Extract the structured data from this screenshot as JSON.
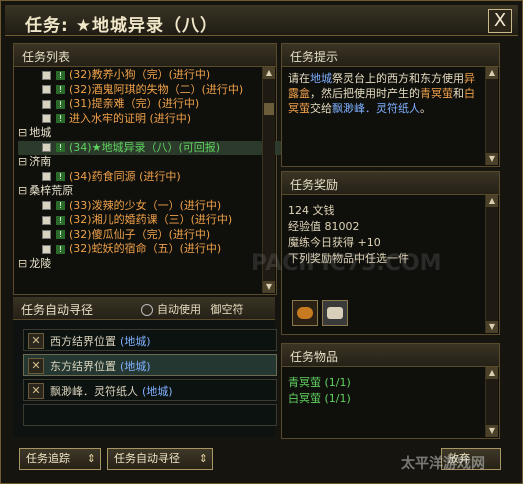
{
  "window": {
    "title": "任务: ★地城异录（八）",
    "close_label": "X"
  },
  "task_list": {
    "header": "任务列表",
    "items": [
      {
        "text": "(32)教养小狗（完）(进行中)",
        "type": "quest",
        "state": "orange"
      },
      {
        "text": "(32)酒鬼阿琪的失物（二）(进行中)",
        "type": "quest",
        "state": "orange"
      },
      {
        "text": "(31)提亲难（完）(进行中)",
        "type": "quest",
        "state": "orange"
      },
      {
        "text": "进入水牢的证明 (进行中)",
        "type": "quest",
        "state": "orange"
      },
      {
        "text": "地城",
        "type": "category"
      },
      {
        "text": "(34)★地城异录（八）(可回报)",
        "type": "quest",
        "state": "green"
      },
      {
        "text": "济南",
        "type": "category"
      },
      {
        "text": "(34)药食同源 (进行中)",
        "type": "quest",
        "state": "orange"
      },
      {
        "text": "桑梓荒原",
        "type": "category"
      },
      {
        "text": "(33)泼辣的少女（一）(进行中)",
        "type": "quest",
        "state": "orange"
      },
      {
        "text": "(32)湘儿的婚药课（三）(进行中)",
        "type": "quest",
        "state": "orange"
      },
      {
        "text": "(32)傻瓜仙子（完）(进行中)",
        "type": "quest",
        "state": "orange"
      },
      {
        "text": "(32)蛇妖的宿命（五）(进行中)",
        "type": "quest",
        "state": "orange"
      },
      {
        "text": "龙陵",
        "type": "category"
      }
    ]
  },
  "auto_route": {
    "header": "任务自动寻径",
    "auto_use_label": "自动使用",
    "item_name": "御空符",
    "rows": [
      {
        "text": "西方结界位置",
        "map": "(地城)"
      },
      {
        "text": "东方结界位置",
        "map": "(地城)"
      },
      {
        "text": "飘渺峰．灵符纸人",
        "map": "(地城)"
      }
    ]
  },
  "buttons": {
    "track": "任务追踪",
    "auto_route": "任务自动寻径",
    "abandon": "放弃"
  },
  "hint": {
    "header": "任务提示",
    "segments": [
      {
        "t": "请在",
        "c": "normal"
      },
      {
        "t": "地城",
        "c": "map"
      },
      {
        "t": "祭灵台上的西方和东方使用",
        "c": "normal"
      },
      {
        "t": "异露盒",
        "c": "orange"
      },
      {
        "t": "，然后把使用时产生的",
        "c": "normal"
      },
      {
        "t": "青冥萤",
        "c": "orange"
      },
      {
        "t": "和",
        "c": "normal"
      },
      {
        "t": "白冥萤",
        "c": "orange"
      },
      {
        "t": "交给",
        "c": "normal"
      },
      {
        "t": "飘渺峰．灵符纸人",
        "c": "map"
      },
      {
        "t": "。",
        "c": "normal"
      }
    ]
  },
  "reward": {
    "header": "任务奖励",
    "lines": [
      "124 文钱",
      "经验值 81002",
      "魔练今日获得 +10",
      "下列奖励物品中任选一件"
    ]
  },
  "items": {
    "header": "任务物品",
    "list": [
      {
        "text": "青冥萤 (1/1)"
      },
      {
        "text": "白冥萤 (1/1)"
      }
    ]
  },
  "watermarks": [
    "PACIFIC73.COM",
    "太平洋游戏网"
  ]
}
